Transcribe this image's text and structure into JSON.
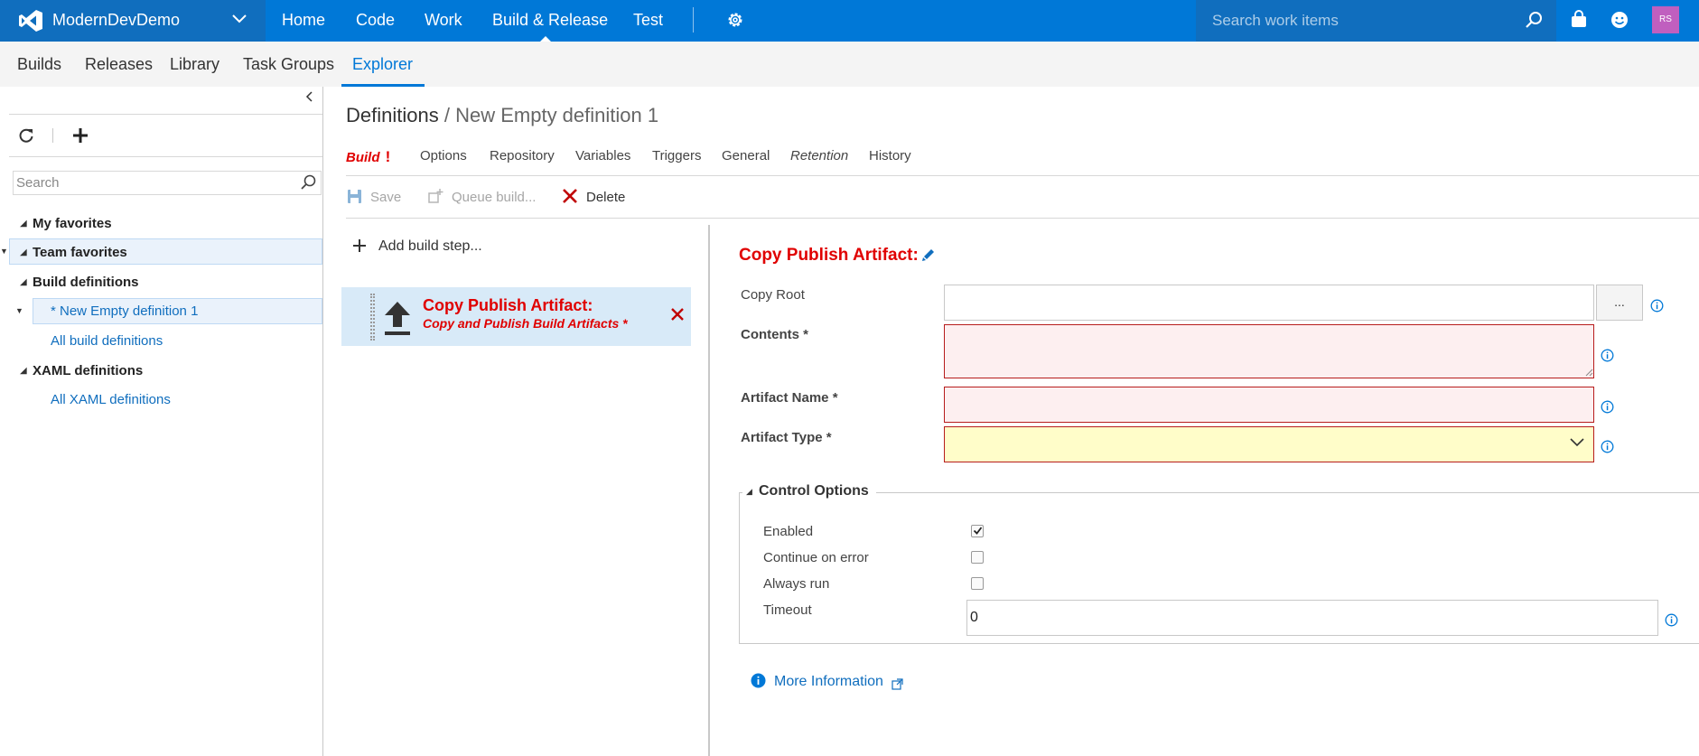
{
  "brand": {
    "name": "ModernDevDemo"
  },
  "top_nav": {
    "items": [
      "Home",
      "Code",
      "Work",
      "Build & Release",
      "Test"
    ],
    "active": "Build & Release"
  },
  "search": {
    "placeholder": "Search work items"
  },
  "user": {
    "initials": "RS"
  },
  "sub_nav": {
    "items": [
      "Builds",
      "Releases",
      "Library",
      "Task Groups",
      "Explorer"
    ],
    "active": "Explorer"
  },
  "left_panel": {
    "search_placeholder": "Search",
    "tree": {
      "my_favorites": "My favorites",
      "team_favorites": "Team favorites",
      "build_definitions": "Build definitions",
      "new_definition": "* New Empty definition 1",
      "all_build_definitions": "All build definitions",
      "xaml_definitions": "XAML definitions",
      "all_xaml_definitions": "All XAML definitions"
    }
  },
  "breadcrumb": {
    "root": "Definitions",
    "separator": "/",
    "current": "New Empty definition 1"
  },
  "tabs": [
    "Build",
    "Options",
    "Repository",
    "Variables",
    "Triggers",
    "General",
    "Retention",
    "History"
  ],
  "tab_error_mark": "!",
  "toolbar": {
    "save": "Save",
    "queue": "Queue build...",
    "delete": "Delete"
  },
  "steps": {
    "add_label": "Add build step...",
    "items": [
      {
        "title": "Copy Publish Artifact:",
        "subtitle": "Copy and Publish Build Artifacts *"
      }
    ]
  },
  "task": {
    "title": "Copy Publish Artifact:",
    "fields": {
      "copy_root": {
        "label": "Copy Root",
        "value": "",
        "browse": "..."
      },
      "contents": {
        "label": "Contents *",
        "value": ""
      },
      "artifact_name": {
        "label": "Artifact Name *",
        "value": ""
      },
      "artifact_type": {
        "label": "Artifact Type *",
        "value": ""
      }
    },
    "control_options": {
      "title": "Control Options",
      "enabled": {
        "label": "Enabled",
        "checked": true
      },
      "continue_on_error": {
        "label": "Continue on error",
        "checked": false
      },
      "always_run": {
        "label": "Always run",
        "checked": false
      },
      "timeout": {
        "label": "Timeout",
        "value": "0"
      }
    },
    "more_info": "More Information"
  },
  "colors": {
    "accent": "#0078d7",
    "brand_bg": "#106ebe",
    "error": "#e00000",
    "link": "#106ebe",
    "avatar": "#c05fbf"
  }
}
